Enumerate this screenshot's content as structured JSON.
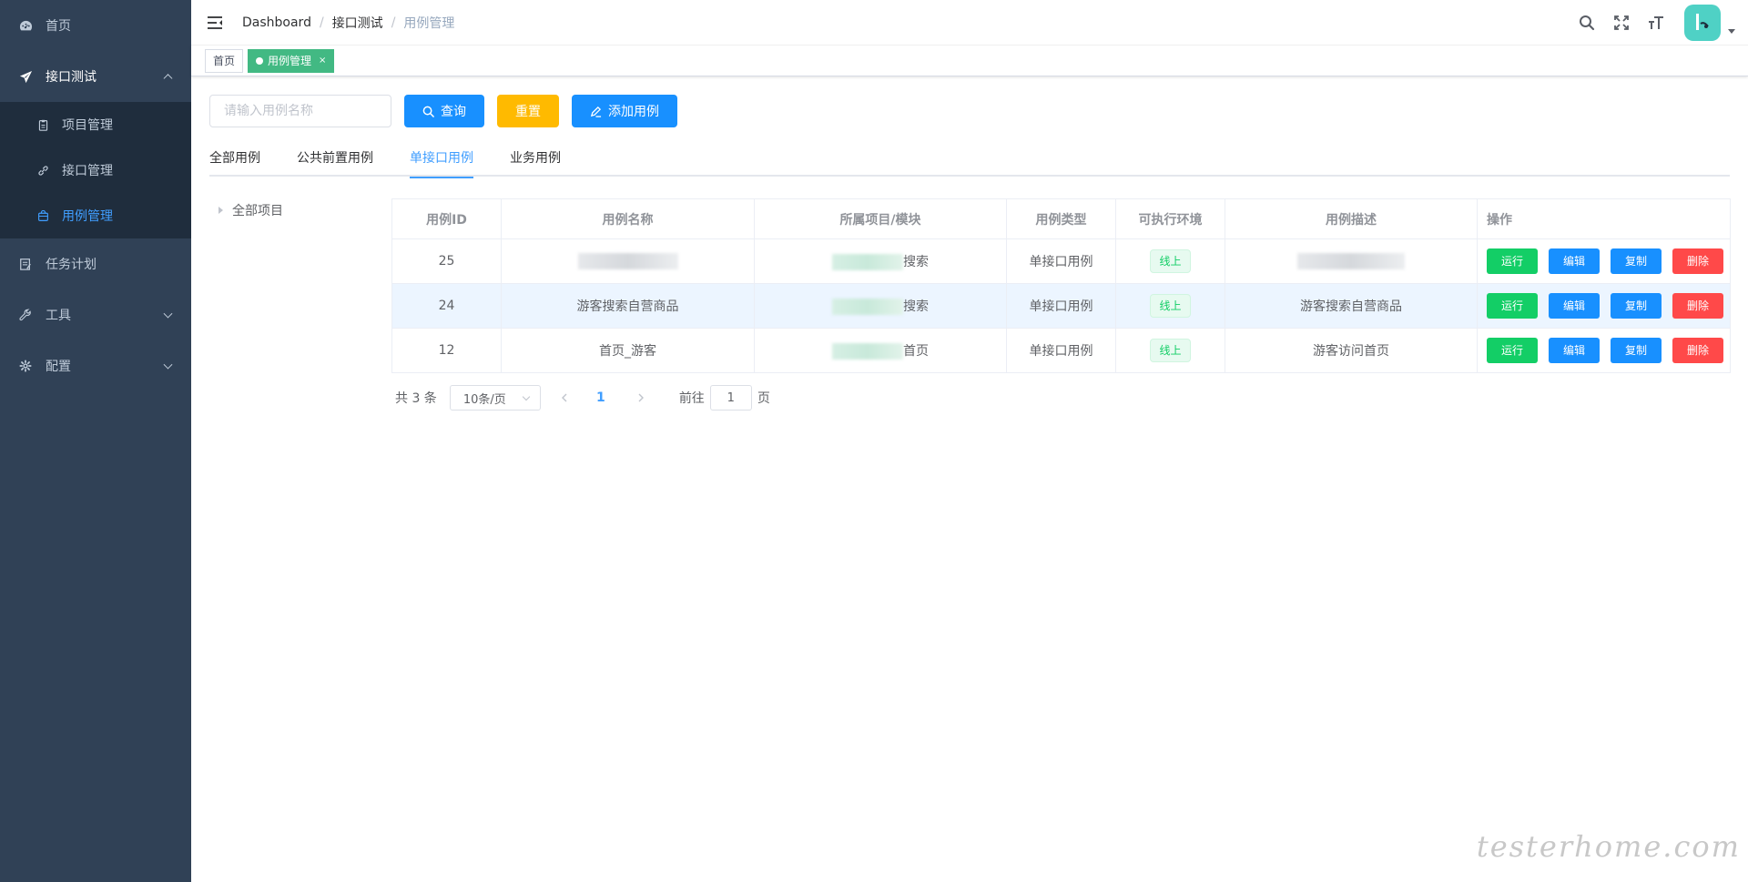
{
  "sidebar": {
    "items": [
      {
        "label": "首页",
        "icon": "dashboard-icon"
      },
      {
        "label": "接口测试",
        "icon": "send-icon",
        "open": true
      },
      {
        "label": "任务计划",
        "icon": "task-icon"
      },
      {
        "label": "工具",
        "icon": "wrench-icon"
      },
      {
        "label": "配置",
        "icon": "gear-icon"
      }
    ],
    "subitems": [
      {
        "label": "项目管理",
        "icon": "clipboard-icon"
      },
      {
        "label": "接口管理",
        "icon": "link-icon"
      },
      {
        "label": "用例管理",
        "icon": "case-icon",
        "active": true
      }
    ]
  },
  "navbar": {
    "breadcrumb": [
      "Dashboard",
      "接口测试",
      "用例管理"
    ]
  },
  "tags": {
    "home": "首页",
    "active": "用例管理",
    "close": "×"
  },
  "search": {
    "placeholder": "请输入用例名称",
    "query_label": "查询",
    "reset_label": "重置",
    "add_label": "添加用例"
  },
  "tabs": [
    "全部用例",
    "公共前置用例",
    "单接口用例",
    "业务用例"
  ],
  "tree": {
    "root": "全部项目"
  },
  "table": {
    "headers": [
      "用例ID",
      "用例名称",
      "所属项目/模块",
      "用例类型",
      "可执行环境",
      "用例描述",
      "操作"
    ],
    "rows": [
      {
        "id": "25",
        "name": "",
        "module": "搜索",
        "type": "单接口用例",
        "env": "线上",
        "desc": ""
      },
      {
        "id": "24",
        "name": "游客搜索自营商品",
        "module": "搜索",
        "type": "单接口用例",
        "env": "线上",
        "desc": "游客搜索自营商品"
      },
      {
        "id": "12",
        "name": "首页_游客",
        "module": "首页",
        "type": "单接口用例",
        "env": "线上",
        "desc": "游客访问首页"
      }
    ],
    "actions": {
      "run": "运行",
      "edit": "编辑",
      "copy": "复制",
      "delete": "删除"
    }
  },
  "pagination": {
    "total": "共 3 条",
    "page_size": "10条/页",
    "current": "1",
    "goto_prefix": "前往",
    "goto_value": "1",
    "goto_suffix": "页"
  },
  "watermark": "testerhome.com",
  "colors": {
    "sidebar_bg": "#304156",
    "primary": "#1890ff",
    "warning": "#ffba00",
    "success": "#13ce66",
    "danger": "#ff4949",
    "tag_active": "#42b983"
  }
}
